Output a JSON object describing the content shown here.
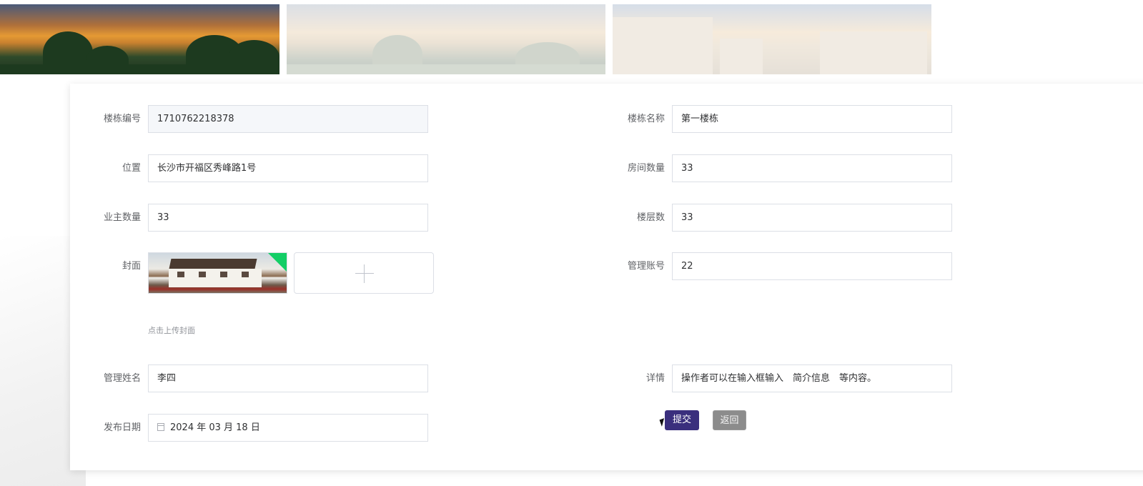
{
  "form": {
    "building_no": {
      "label": "楼栋编号",
      "value": "1710762218378"
    },
    "building_name": {
      "label": "楼栋名称",
      "value": "第一楼栋"
    },
    "location": {
      "label": "位置",
      "value": "长沙市开福区秀峰路1号"
    },
    "room_count": {
      "label": "房间数量",
      "value": "33"
    },
    "owner_count": {
      "label": "业主数量",
      "value": "33"
    },
    "floor_count": {
      "label": "楼层数",
      "value": "33"
    },
    "cover": {
      "label": "封面",
      "hint": "点击上传封面"
    },
    "manager_account": {
      "label": "管理账号",
      "value": "22"
    },
    "manager_name": {
      "label": "管理姓名",
      "value": "李四"
    },
    "details": {
      "label": "详情",
      "value": "操作者可以在输入框输入　简介信息　等内容。"
    },
    "publish_date": {
      "label": "发布日期",
      "value": "2024 年 03 月 18 日"
    }
  },
  "buttons": {
    "submit": "提交",
    "back": "返回"
  },
  "icons": {
    "date": "calendar-icon",
    "upload": "plus-icon",
    "uploaded": "check-corner-icon"
  },
  "colors": {
    "submit": "#3a2f7d",
    "back": "#8c8c8c",
    "uploaded_badge": "#13ce66",
    "border": "#dcdfe6"
  }
}
